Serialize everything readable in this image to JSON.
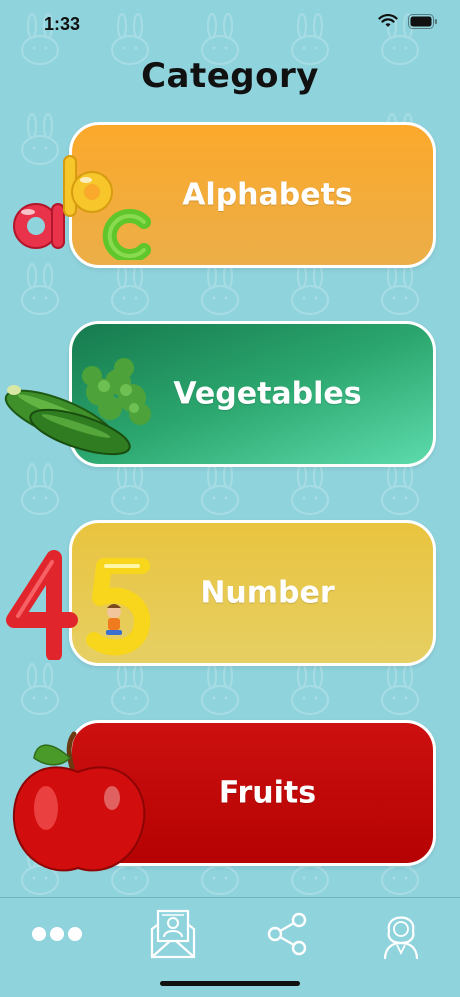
{
  "status": {
    "time": "1:33"
  },
  "page": {
    "title": "Category"
  },
  "categories": [
    {
      "label": "Alphabets"
    },
    {
      "label": "Vegetables"
    },
    {
      "label": "Number"
    },
    {
      "label": "Fruits"
    }
  ],
  "tabbar": {
    "icons": [
      "more-icon",
      "contact-card-icon",
      "share-icon",
      "profile-icon"
    ]
  },
  "colors": {
    "background": "#8fd3dd",
    "alphabets": "#fba92b",
    "vegetables": "#1b8a57",
    "number": "#e9c43f",
    "fruits": "#c50808"
  }
}
